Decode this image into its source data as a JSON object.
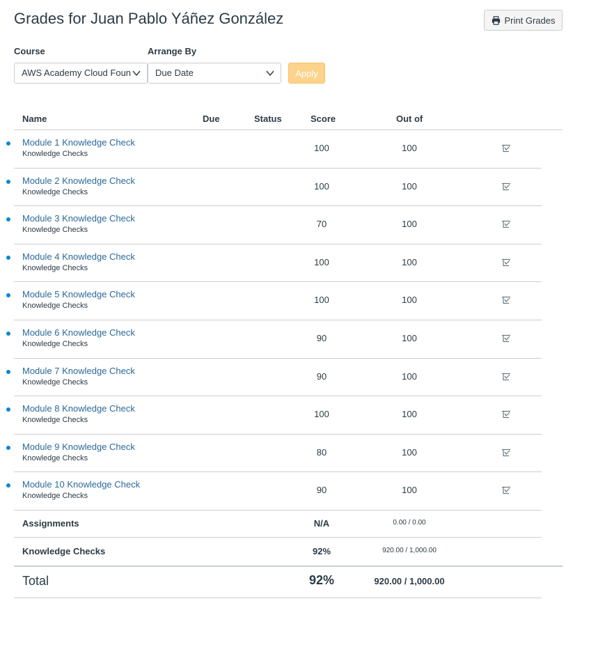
{
  "page": {
    "title": "Grades for Juan Pablo Yáñez González",
    "print_label": "Print Grades"
  },
  "filters": {
    "course_label": "Course",
    "course_value": "AWS Academy Cloud Foun",
    "arrange_label": "Arrange By",
    "arrange_value": "Due Date",
    "apply_label": "Apply"
  },
  "table": {
    "headers": {
      "name": "Name",
      "due": "Due",
      "status": "Status",
      "score": "Score",
      "out_of": "Out of"
    },
    "rows": [
      {
        "name": "Module 1 Knowledge Check",
        "group": "Knowledge Checks",
        "score": "100",
        "out_of": "100"
      },
      {
        "name": "Module 2 Knowledge Check",
        "group": "Knowledge Checks",
        "score": "100",
        "out_of": "100"
      },
      {
        "name": "Module 3 Knowledge Check",
        "group": "Knowledge Checks",
        "score": "70",
        "out_of": "100"
      },
      {
        "name": "Module 4 Knowledge Check",
        "group": "Knowledge Checks",
        "score": "100",
        "out_of": "100"
      },
      {
        "name": "Module 5 Knowledge Check",
        "group": "Knowledge Checks",
        "score": "100",
        "out_of": "100"
      },
      {
        "name": "Module 6 Knowledge Check",
        "group": "Knowledge Checks",
        "score": "90",
        "out_of": "100"
      },
      {
        "name": "Module 7 Knowledge Check",
        "group": "Knowledge Checks",
        "score": "90",
        "out_of": "100"
      },
      {
        "name": "Module 8 Knowledge Check",
        "group": "Knowledge Checks",
        "score": "100",
        "out_of": "100"
      },
      {
        "name": "Module 9 Knowledge Check",
        "group": "Knowledge Checks",
        "score": "80",
        "out_of": "100"
      },
      {
        "name": "Module 10 Knowledge Check",
        "group": "Knowledge Checks",
        "score": "90",
        "out_of": "100"
      }
    ],
    "groups": [
      {
        "name": "Assignments",
        "score": "N/A",
        "out_of": "0.00 / 0.00"
      },
      {
        "name": "Knowledge Checks",
        "score": "92%",
        "out_of": "920.00 / 1,000.00"
      }
    ],
    "total": {
      "name": "Total",
      "score": "92%",
      "out_of": "920.00 / 1,000.00"
    }
  },
  "colors": {
    "link": "#2b6a98",
    "unread_dot": "#0b87d3",
    "apply_bg": "#fdd28a",
    "border": "#c7cdd1"
  },
  "icons": {
    "print": "printer-icon",
    "rubric": "rubric-icon",
    "dropdown": "chevron-down-icon"
  }
}
